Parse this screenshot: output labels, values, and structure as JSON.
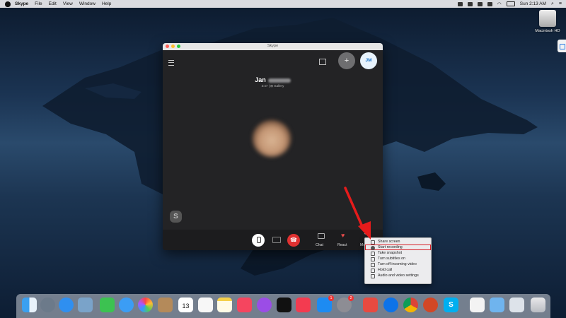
{
  "menubar": {
    "app_name": "Skype",
    "items": [
      "File",
      "Edit",
      "View",
      "Window",
      "Help"
    ],
    "clock": "Sun 2:13 AM"
  },
  "desktop": {
    "disk_label": "Macintosh HD"
  },
  "skype_window": {
    "title": "Skype",
    "avatar_initials": "JM",
    "callee_first_name": "Jan",
    "call_subtitle": "3:47 | ⊞ Gallery",
    "logo_letter": "S",
    "controls": {
      "chat_label": "Chat",
      "react_label": "React",
      "more_label": "More"
    }
  },
  "context_menu": {
    "items": [
      {
        "label": "Share screen",
        "icon": "share-screen-icon"
      },
      {
        "label": "Start recording",
        "icon": "record-icon",
        "highlighted": true
      },
      {
        "label": "Take snapshot",
        "icon": "camera-icon"
      },
      {
        "label": "Turn subtitles on",
        "icon": "subtitles-icon"
      },
      {
        "label": "Turn off incoming video",
        "icon": "video-off-icon"
      },
      {
        "label": "Hold call",
        "icon": "hold-icon"
      },
      {
        "label": "Audio and video settings",
        "icon": "gear-icon"
      }
    ]
  },
  "dock": {
    "calendar_date": "13",
    "appstore_badge": "1",
    "prefs_badge": "2",
    "apps": [
      "finder",
      "launchpad",
      "safari",
      "preview",
      "facetime",
      "messages",
      "photos",
      "contacts",
      "calendar",
      "reminders",
      "notes",
      "music",
      "podcasts",
      "apple-tv",
      "news",
      "app-store",
      "system-preferences",
      "anydesk",
      "teamviewer",
      "chrome",
      "powerpoint",
      "skype",
      "textedit",
      "folder",
      "preview-window",
      "trash"
    ]
  },
  "colors": {
    "accent_red": "#e03131",
    "highlight_outline": "#d61f26",
    "skype_blue": "#00aff0"
  }
}
